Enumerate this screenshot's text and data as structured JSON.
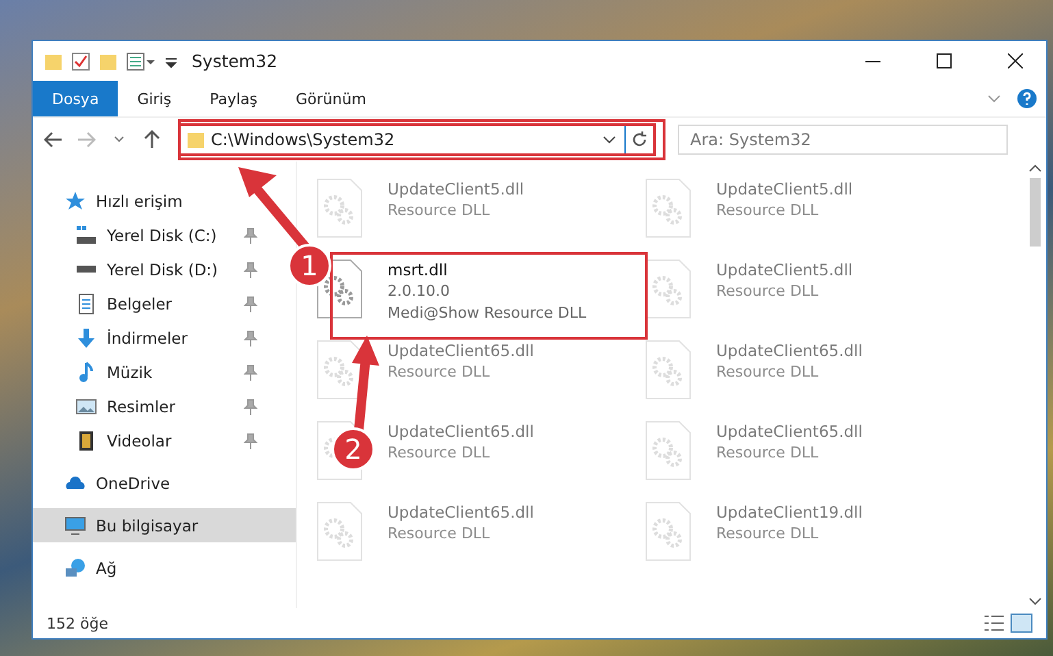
{
  "window": {
    "title": "System32"
  },
  "ribbon_tabs": [
    {
      "label": "Dosya",
      "selected": true
    },
    {
      "label": "Giriş",
      "selected": false
    },
    {
      "label": "Paylaş",
      "selected": false
    },
    {
      "label": "Görünüm",
      "selected": false
    }
  ],
  "address": {
    "path": "C:\\Windows\\System32"
  },
  "search": {
    "placeholder": "Ara: System32"
  },
  "sidebar": {
    "items": [
      {
        "label": "Hızlı erişim",
        "kind": "star",
        "selected": false,
        "children": [
          {
            "label": "Yerel Disk (C:)",
            "kind": "drive-win",
            "pinned": true,
            "selected": false
          },
          {
            "label": "Yerel Disk (D:)",
            "kind": "drive",
            "pinned": true,
            "selected": false
          },
          {
            "label": "Belgeler",
            "kind": "document",
            "pinned": true,
            "selected": false
          },
          {
            "label": "İndirmeler",
            "kind": "download",
            "pinned": true,
            "selected": false
          },
          {
            "label": "Müzik",
            "kind": "music",
            "pinned": true,
            "selected": false
          },
          {
            "label": "Resimler",
            "kind": "picture",
            "pinned": true,
            "selected": false
          },
          {
            "label": "Videolar",
            "kind": "video",
            "pinned": true,
            "selected": false
          }
        ]
      },
      {
        "label": "OneDrive",
        "kind": "cloud",
        "selected": false
      },
      {
        "label": "Bu bilgisayar",
        "kind": "computer",
        "selected": true
      },
      {
        "label": "Ağ",
        "kind": "network",
        "selected": false
      }
    ]
  },
  "files": [
    {
      "name": "UpdateClient5.dll",
      "type": "Resource DLL",
      "blurred": true
    },
    {
      "name": "UpdateClient5.dll",
      "type": "Resource DLL",
      "blurred": true
    },
    {
      "name": "msrt.dll",
      "version": "2.0.10.0",
      "type": "Medi@Show Resource DLL",
      "blurred": false
    },
    {
      "name": "UpdateClient5.dll",
      "type": "Resource DLL",
      "blurred": true
    },
    {
      "name": "UpdateClient65.dll",
      "type": "Resource DLL",
      "blurred": true
    },
    {
      "name": "UpdateClient65.dll",
      "type": "Resource DLL",
      "blurred": true
    },
    {
      "name": "UpdateClient65.dll",
      "type": "Resource DLL",
      "blurred": true
    },
    {
      "name": "UpdateClient65.dll",
      "type": "Resource DLL",
      "blurred": true
    },
    {
      "name": "UpdateClient65.dll",
      "type": "Resource DLL",
      "blurred": true
    },
    {
      "name": "UpdateClient19.dll",
      "type": "Resource DLL",
      "blurred": true
    }
  ],
  "status_bar": {
    "count": "152 öğe"
  },
  "callouts": [
    {
      "number": "1"
    },
    {
      "number": "2"
    }
  ]
}
